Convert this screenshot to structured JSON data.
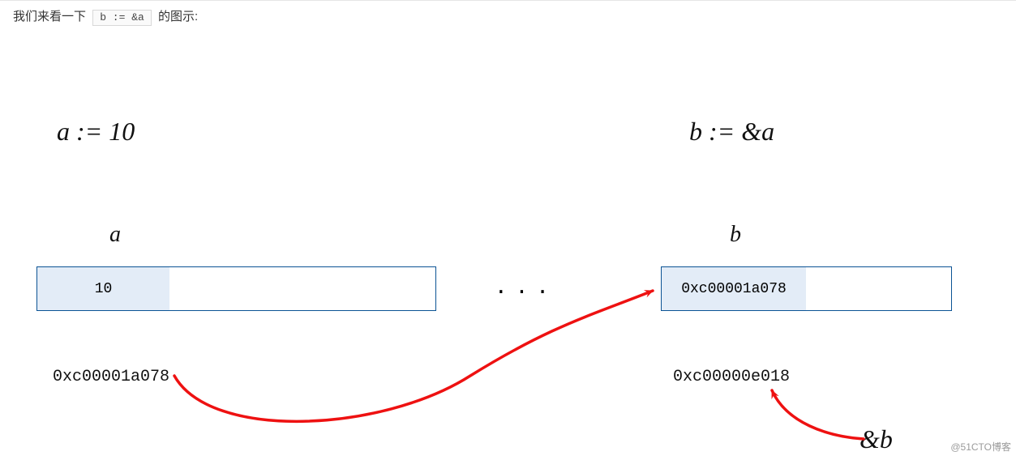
{
  "header": {
    "pre": "我们来看一下",
    "code": "b := &a",
    "post": "的图示:"
  },
  "diagram": {
    "decl_a": "a := 10",
    "decl_b": "b := &a",
    "label_a": "a",
    "label_b": "b",
    "value_a": "10",
    "value_b": "0xc00001a078",
    "addr_a": "0xc00001a078",
    "addr_b": "0xc00000e018",
    "amp_b": "&b",
    "ellipsis": "..."
  },
  "watermark": "@51CTO博客"
}
